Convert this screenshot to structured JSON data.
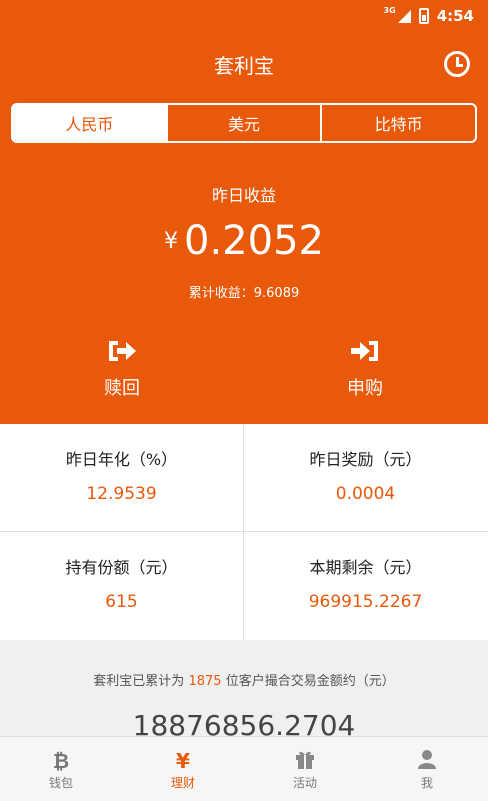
{
  "status_bar": {
    "network": "3G",
    "time": "4:54"
  },
  "header": {
    "title": "套利宝"
  },
  "currency_tabs": [
    {
      "label": "人民币",
      "active": true
    },
    {
      "label": "美元",
      "active": false
    },
    {
      "label": "比特币",
      "active": false
    }
  ],
  "earnings": {
    "label": "昨日收益",
    "currency_symbol": "¥",
    "value": "0.2052",
    "cumulative_label": "累计收益：",
    "cumulative_value": "9.6089"
  },
  "actions": {
    "redeem_label": "赎回",
    "purchase_label": "申购"
  },
  "stats": {
    "annual_rate_label": "昨日年化（%）",
    "annual_rate_value": "12.9539",
    "reward_label": "昨日奖励（元）",
    "reward_value": "0.0004",
    "holding_label": "持有份额（元）",
    "holding_value": "615",
    "remaining_label": "本期剩余（元）",
    "remaining_value": "969915.2267"
  },
  "summary": {
    "text_prefix": "套利宝已累计为",
    "customer_count": "1875",
    "text_suffix": "位客户撮合交易金额约（元）",
    "total_amount": "18876856.2704"
  },
  "bottom_nav": [
    {
      "label": "钱包",
      "icon": "bitcoin-icon",
      "active": false
    },
    {
      "label": "理财",
      "icon": "yen-icon",
      "active": true
    },
    {
      "label": "活动",
      "icon": "gift-icon",
      "active": false
    },
    {
      "label": "我",
      "icon": "person-icon",
      "active": false
    }
  ],
  "colors": {
    "accent": "#e8590c",
    "background": "#f0f0f0"
  }
}
